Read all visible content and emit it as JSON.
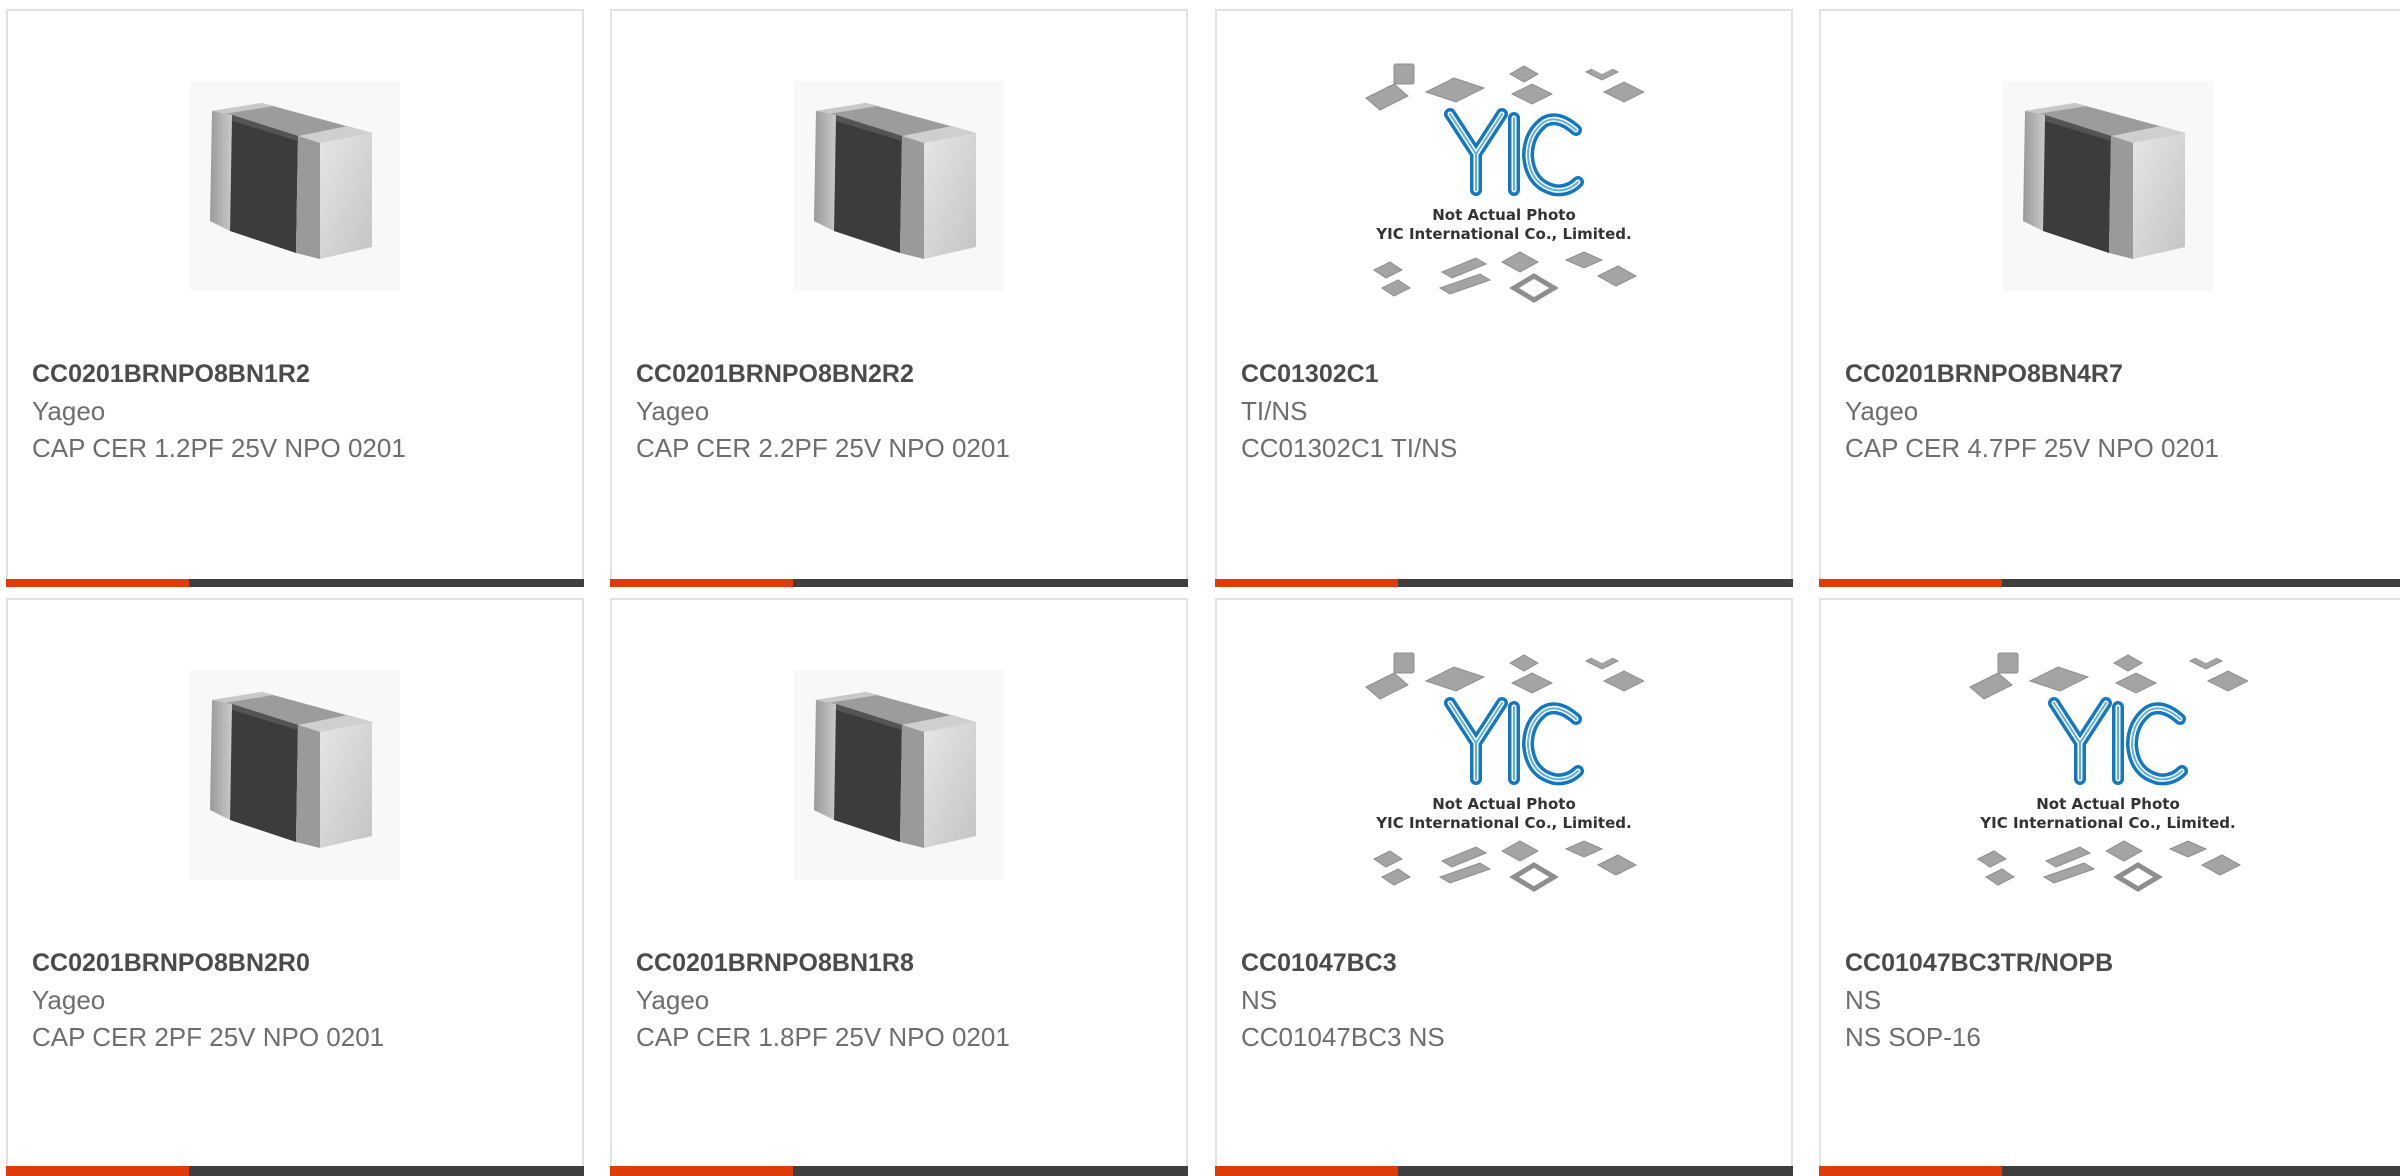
{
  "colors": {
    "accent": "#e03c0b",
    "bar_dark": "#3f3f3f",
    "border": "#e2e2e2"
  },
  "placeholder": {
    "logo_text": "YIC",
    "line1": "Not Actual Photo",
    "line2": "YIC International Co., Limited."
  },
  "products": [
    {
      "part_number": "CC0201BRNPO8BN1R2",
      "manufacturer": "Yageo",
      "description": "CAP CER 1.2PF 25V NPO 0201",
      "image": "capacitor-chip-icon"
    },
    {
      "part_number": "CC0201BRNPO8BN2R2",
      "manufacturer": "Yageo",
      "description": "CAP CER 2.2PF 25V NPO 0201",
      "image": "capacitor-chip-icon"
    },
    {
      "part_number": "CC01302C1",
      "manufacturer": "TI/NS",
      "description": "CC01302C1 TI/NS",
      "image": "not-actual-photo-placeholder"
    },
    {
      "part_number": "CC0201BRNPO8BN4R7",
      "manufacturer": "Yageo",
      "description": "CAP CER 4.7PF 25V NPO 0201",
      "image": "capacitor-chip-icon"
    },
    {
      "part_number": "CC0201BRNPO8BN2R0",
      "manufacturer": "Yageo",
      "description": "CAP CER 2PF 25V NPO 0201",
      "image": "capacitor-chip-icon"
    },
    {
      "part_number": "CC0201BRNPO8BN1R8",
      "manufacturer": "Yageo",
      "description": "CAP CER 1.8PF 25V NPO 0201",
      "image": "capacitor-chip-icon"
    },
    {
      "part_number": "CC01047BC3",
      "manufacturer": "NS",
      "description": "CC01047BC3 NS",
      "image": "not-actual-photo-placeholder"
    },
    {
      "part_number": "CC01047BC3TR/NOPB",
      "manufacturer": "NS",
      "description": "NS SOP-16",
      "image": "not-actual-photo-placeholder"
    }
  ]
}
